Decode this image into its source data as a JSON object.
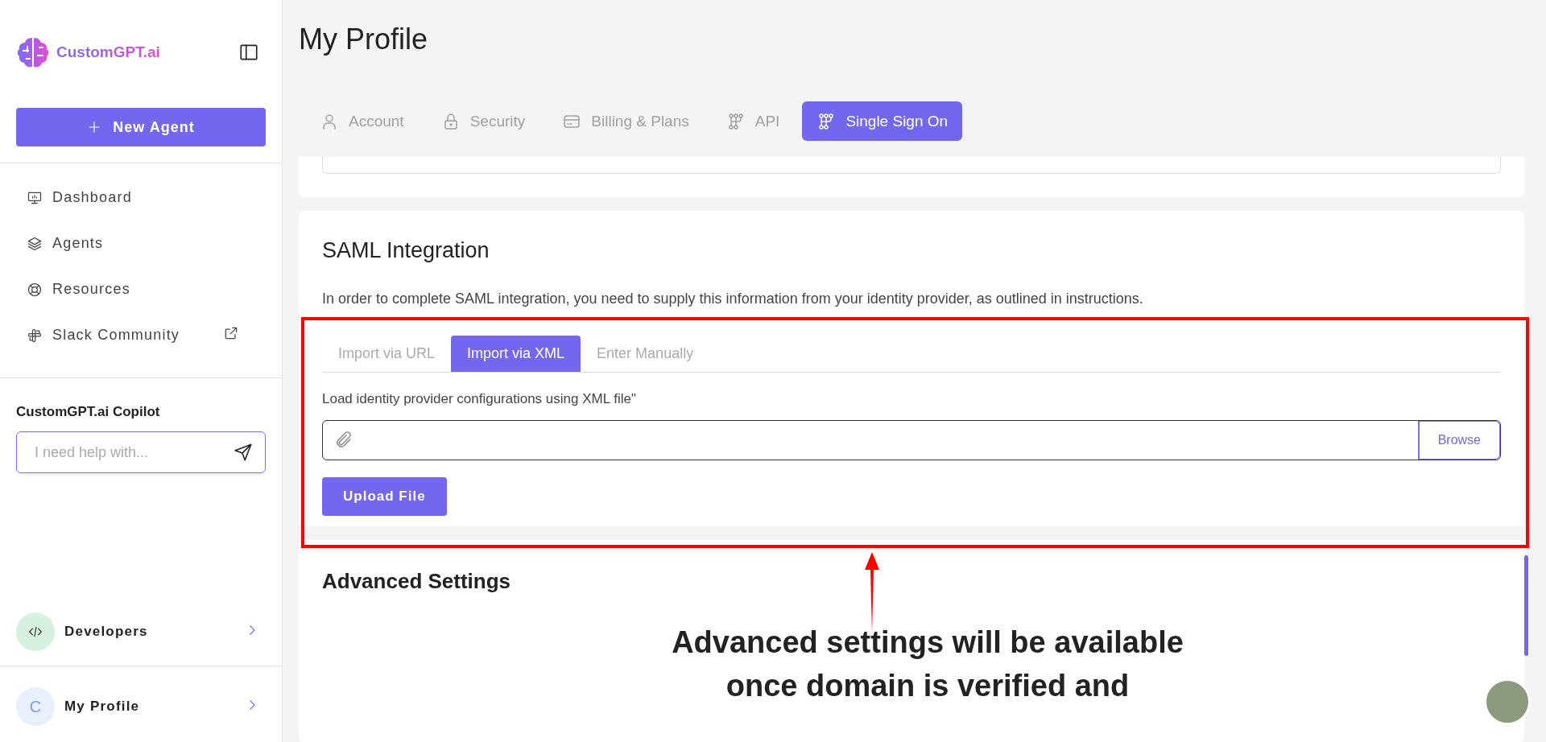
{
  "sidebar": {
    "logo": "CustomGPT.ai",
    "new_agent_button": "New Agent",
    "nav_items": [
      {
        "label": "Dashboard",
        "external": false
      },
      {
        "label": "Agents",
        "external": false
      },
      {
        "label": "Resources",
        "external": false
      },
      {
        "label": "Slack Community",
        "external": true
      }
    ],
    "copilot": {
      "title": "CustomGPT.ai Copilot",
      "placeholder": "I need help with..."
    },
    "footer_items": [
      {
        "label": "Developers",
        "kind": "code"
      },
      {
        "label": "My Profile",
        "kind": "initial",
        "initial": "C"
      }
    ]
  },
  "page_title": "My Profile",
  "tabs": [
    {
      "label": "Account",
      "selected": false
    },
    {
      "label": "Security",
      "selected": false
    },
    {
      "label": "Billing & Plans",
      "selected": false
    },
    {
      "label": "API",
      "selected": false
    },
    {
      "label": "Single Sign On",
      "selected": true
    }
  ],
  "saml": {
    "title": "SAML Integration",
    "description": "In order to complete SAML integration, you need to supply this information from your identity provider, as outlined in instructions.",
    "import_tabs": [
      {
        "label": "Import via URL",
        "selected": false
      },
      {
        "label": "Import via XML",
        "selected": true
      },
      {
        "label": "Enter Manually",
        "selected": false
      }
    ],
    "hint": "Load identity provider configurations using XML file\"",
    "browse_button": "Browse",
    "upload_button": "Upload File"
  },
  "advanced": {
    "title": "Advanced Settings"
  },
  "annotation": {
    "lines": [
      "Advanced settings will be available",
      "once domain is verified and"
    ]
  }
}
